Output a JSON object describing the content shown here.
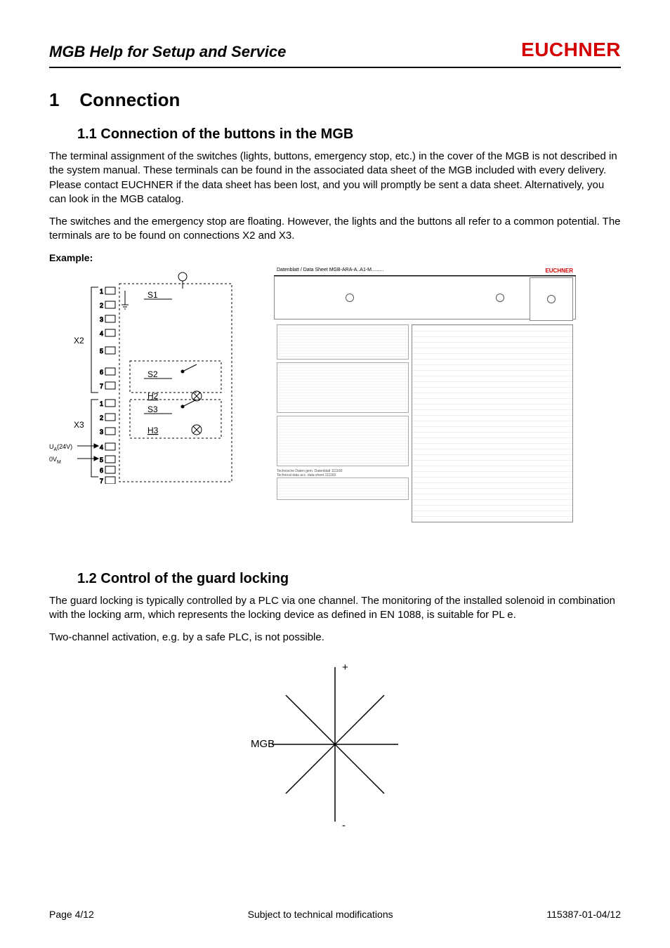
{
  "header": {
    "doc_title": "MGB Help for Setup and Service",
    "brand": "EUCHNER"
  },
  "chapter": {
    "number": "1",
    "title": "Connection"
  },
  "section1": {
    "number": "1.1",
    "title": "Connection of the buttons in the MGB",
    "p1": "The terminal assignment of the switches (lights, buttons, emergency stop, etc.) in the cover of the MGB is not described in the system manual. These terminals can be found in the associated data sheet of the MGB included with every delivery. Please contact EUCHNER if the data sheet has been lost, and you will promptly be sent a data sheet. Alternatively, you can look in the MGB catalog.",
    "p2": "The switches and the emergency stop are floating. However, the lights and the buttons all refer to a common potential. The terminals are to be found on connections X2 and X3.",
    "example_label": "Example:"
  },
  "wiring": {
    "x2": "X2",
    "x3": "X3",
    "ua": "U",
    "ua_sub": "A",
    "ua_val": "(24V)",
    "ov": "0V",
    "ov_sub": "M",
    "s1": "S1",
    "s2": "S2",
    "s3": "S3",
    "h2": "H2",
    "h3": "H3",
    "pins": [
      "1",
      "2",
      "3",
      "4",
      "5",
      "6",
      "7",
      "1",
      "2",
      "3",
      "4",
      "5",
      "6",
      "7"
    ]
  },
  "datasheet": {
    "title": "Datenblatt / Data Sheet   MGB-ARA-A..A1-M.........",
    "brand": "EUCHNER",
    "tech_line1": "Technische Daten gem. Datenblatt 111160",
    "tech_line2": "Technical data acc. data sheet 111160"
  },
  "section2": {
    "number": "1.2",
    "title": "Control of the guard locking",
    "p1": "The guard locking is typically controlled by a PLC via one channel. The monitoring of the installed solenoid in combination with the locking arm, which represents the locking device as defined in EN 1088, is suitable for PL e.",
    "p2": "Two-channel activation, e.g. by a safe PLC, is not possible."
  },
  "cross": {
    "plus": "+",
    "minus": "-",
    "mgb": "MGB"
  },
  "footer": {
    "left": "Page 4/12",
    "center": "Subject to technical modifications",
    "right": "115387-01-04/12"
  }
}
